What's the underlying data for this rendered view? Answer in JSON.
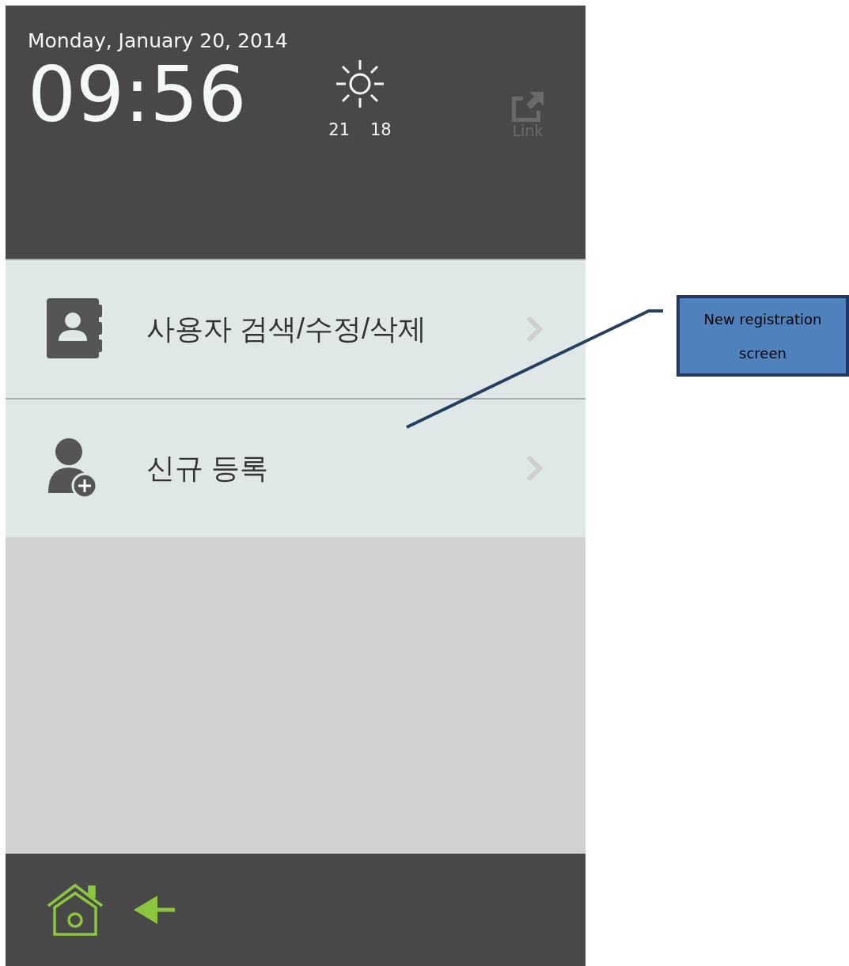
{
  "header": {
    "date": "Monday, January 20, 2014",
    "time": "09:56",
    "weather": {
      "kind": "sunny",
      "high": "21",
      "low": "18"
    },
    "link": {
      "label": "Link",
      "disabled": true
    }
  },
  "menu": [
    {
      "label": "사용자 검색/수정/삭제",
      "kind": "contacts"
    },
    {
      "label": "신규 등록",
      "kind": "add-user"
    }
  ],
  "callout": {
    "text": "New registration screen"
  }
}
